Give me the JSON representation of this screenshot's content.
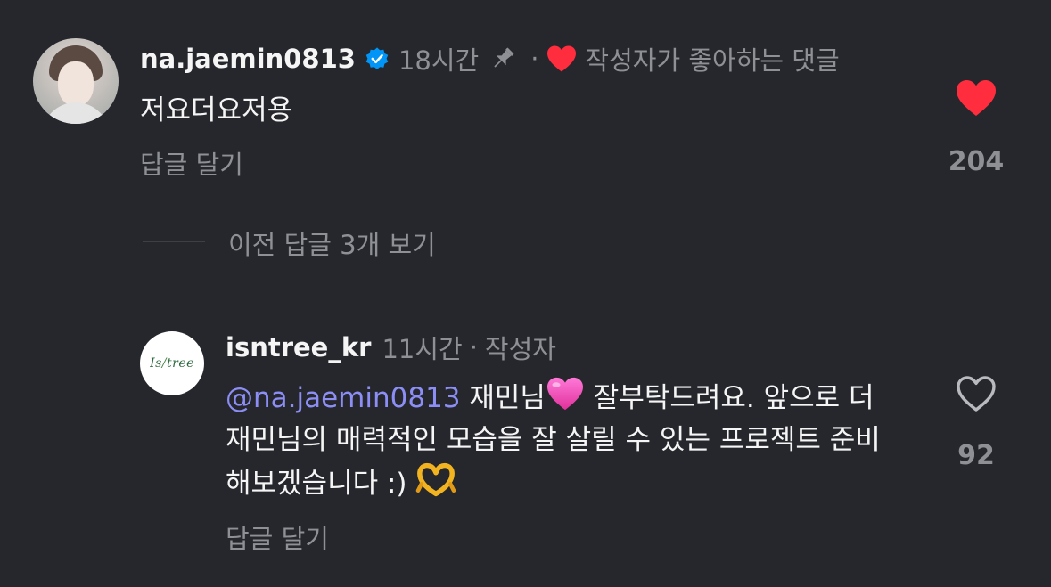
{
  "comment1": {
    "username": "na.jaemin0813",
    "time": "18시간",
    "dot": "·",
    "liked_by_author_label": "작성자가 좋아하는 댓글",
    "text": "저요더요저용",
    "reply_label": "답글 달기",
    "like_count": "204",
    "liked": true,
    "verified": true,
    "pinned": true
  },
  "view_previous_replies": "이전 답글 3개 보기",
  "comment2": {
    "username": "isntree_kr",
    "time": "11시간",
    "dot": "·",
    "author_badge": "작성자",
    "avatar_logo_text": "Isntree",
    "mention": "@na.jaemin0813",
    "text_part1": " 재민님",
    "text_part2": " 잘부탁드려요. 앞으로 더 재민님의 매력적인 모습을 잘 살릴 수 있는 프로젝트 준비해보겠습니다 :) ",
    "emoji1": "pink-heart",
    "emoji2": "heart-hands",
    "reply_label": "답글 달기",
    "like_count": "92",
    "liked": false
  },
  "colors": {
    "background": "#25272c",
    "primary_text": "#f5f5f5",
    "secondary_text": "#8e9096",
    "mention": "#8c8ef6",
    "like_red": "#ff2d3d",
    "verified_blue": "#0095f6"
  }
}
